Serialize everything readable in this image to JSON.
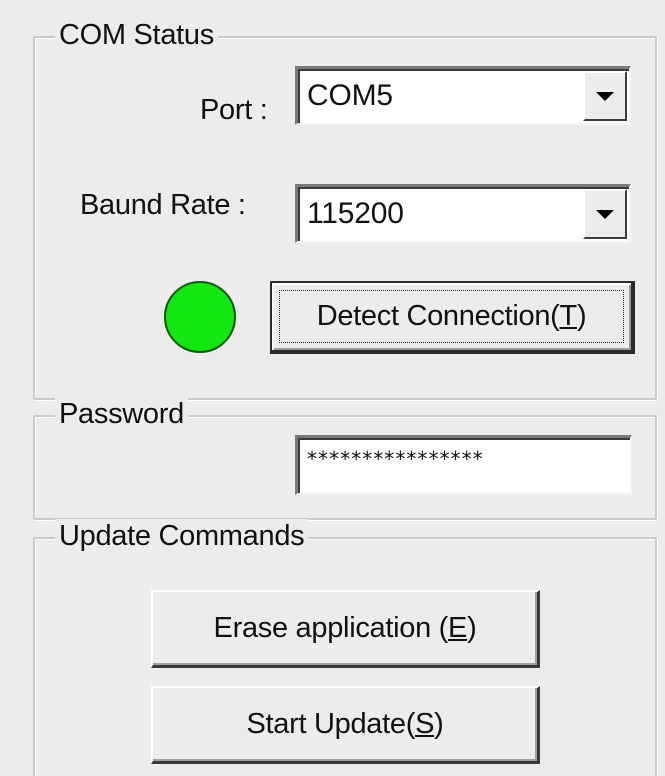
{
  "com_status": {
    "title": "COM Status",
    "port_label": "Port :",
    "port_value": "COM5",
    "baud_label": "Baund Rate :",
    "baud_value": "115200",
    "indicator_color": "#13e613",
    "detect_button_text": "Detect Connection(",
    "detect_button_key": "T",
    "detect_button_suffix": ")"
  },
  "password": {
    "title": "Password",
    "value": "****************"
  },
  "update_commands": {
    "title": "Update Commands",
    "erase_button_text": "Erase application (",
    "erase_button_key": "E",
    "erase_button_suffix": ")",
    "start_button_text": "Start Update(",
    "start_button_key": "S",
    "start_button_suffix": ")"
  }
}
